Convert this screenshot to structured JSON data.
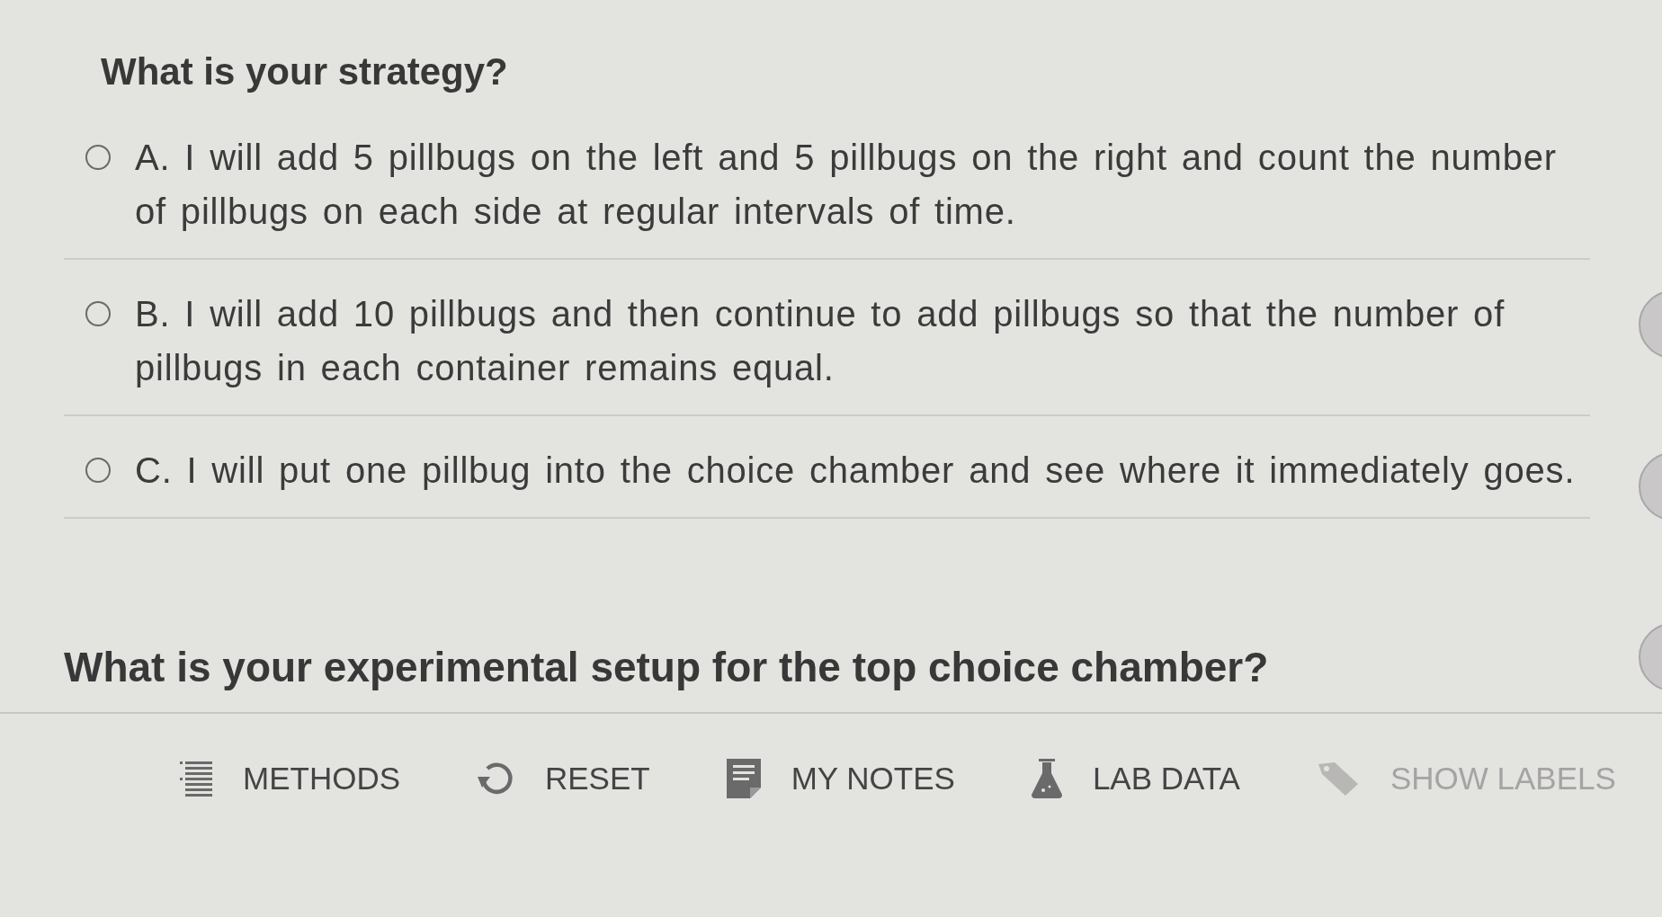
{
  "question": {
    "title": "What is your strategy?"
  },
  "options": [
    {
      "text": "A. I will add 5 pillbugs on the left and 5 pillbugs on the right and count the number of pillbugs on each side at regular intervals of time.",
      "selected": false
    },
    {
      "text": "B. I will add 10 pillbugs and then continue to add pillbugs so that the number of pillbugs in each container remains equal.",
      "selected": false
    },
    {
      "text": "C. I will put one pillbug into the choice chamber and see where it immediately goes.",
      "selected": false
    }
  ],
  "next_question": {
    "title": "What is your experimental setup for the top choice chamber?"
  },
  "toolbar": [
    {
      "kind": "methods",
      "label": "METHODS",
      "disabled": false
    },
    {
      "kind": "reset",
      "label": "RESET",
      "disabled": false
    },
    {
      "kind": "notes",
      "label": "MY NOTES",
      "disabled": false
    },
    {
      "kind": "lab_data",
      "label": "LAB DATA",
      "disabled": false
    },
    {
      "kind": "labels",
      "label": "SHOW LABELS",
      "disabled": true
    }
  ]
}
